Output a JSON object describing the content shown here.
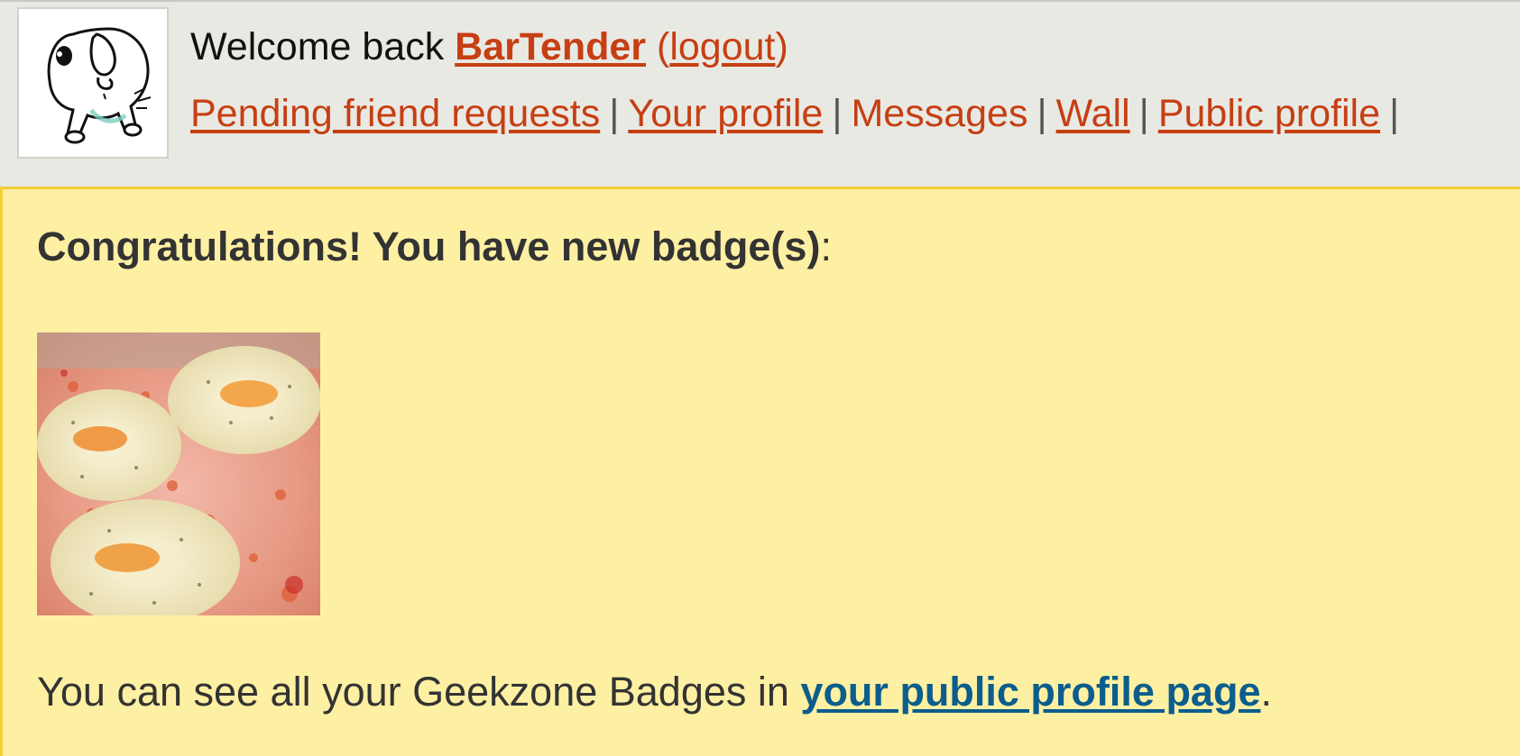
{
  "header": {
    "welcome_prefix": "Welcome back",
    "username": "BarTender",
    "logout_open": "(",
    "logout_label": "logout",
    "logout_close": ")",
    "avatar_icon": "cartoon-dog-icon"
  },
  "nav": {
    "separator": "|",
    "items": [
      {
        "label": "Pending friend requests",
        "linked": true
      },
      {
        "label": "Your profile",
        "linked": true
      },
      {
        "label": "Messages",
        "linked": false
      },
      {
        "label": "Wall",
        "linked": true
      },
      {
        "label": "Public profile",
        "linked": true
      }
    ]
  },
  "notice": {
    "title_bold": "Congratulations! You have new badge(s)",
    "title_tail": ":",
    "badge_image": "pizza-badge-image",
    "body_prefix": "You can see all your Geekzone Badges in",
    "body_link": "your public profile page",
    "body_suffix": "."
  },
  "colors": {
    "link_orange": "#c63f12",
    "link_blue": "#0b5d8c",
    "header_bg": "#e9e9e4",
    "notice_bg": "#fef0a3",
    "notice_border": "#f3cd3a"
  }
}
